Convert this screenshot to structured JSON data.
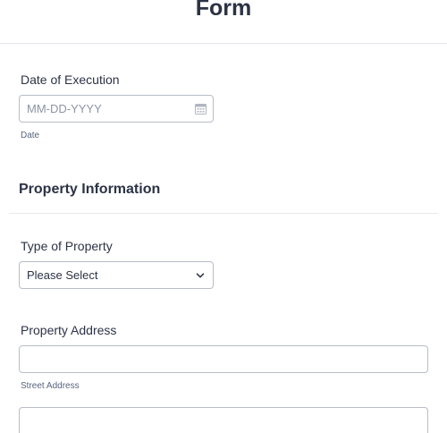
{
  "form": {
    "title": "Form"
  },
  "date_of_execution": {
    "label": "Date of Execution",
    "placeholder": "MM-DD-YYYY",
    "sublabel": "Date",
    "icon": "calendar-icon"
  },
  "property_section": {
    "heading": "Property Information"
  },
  "type_of_property": {
    "label": "Type of Property",
    "selected": "Please Select",
    "icon": "chevron-down-icon"
  },
  "property_address": {
    "label": "Property Address",
    "street_sublabel": "Street Address",
    "street_value": "",
    "street2_value": ""
  },
  "colors": {
    "text": "#2c3345",
    "border": "#b8bdc9",
    "placeholder": "#8d94a6",
    "divider": "#e3e5ea"
  }
}
